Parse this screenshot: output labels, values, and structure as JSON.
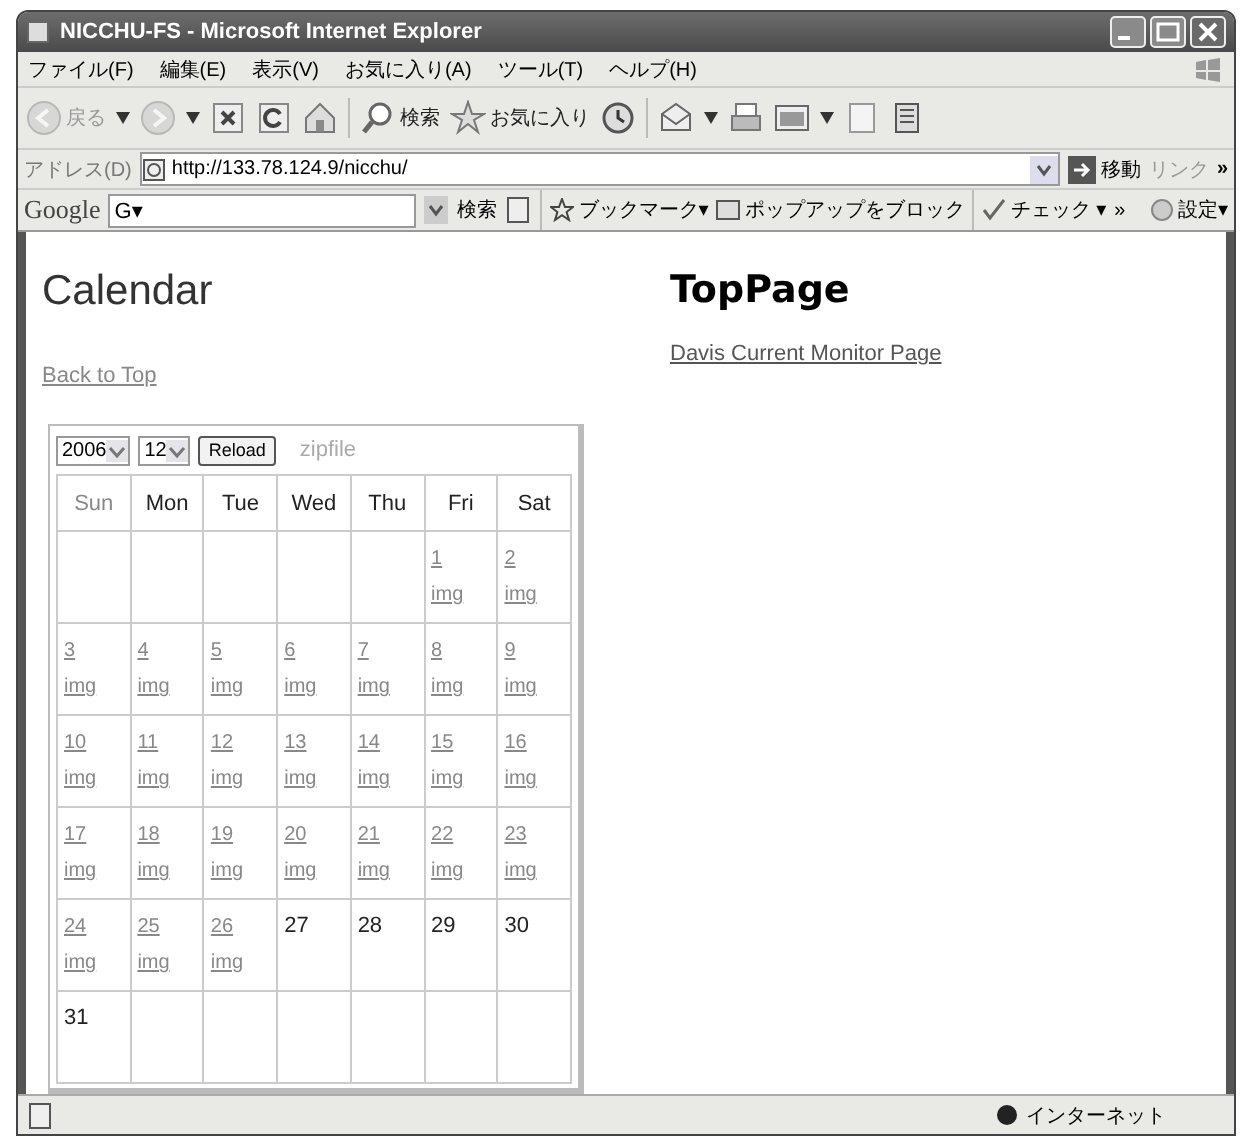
{
  "window": {
    "title": "NICCHU-FS - Microsoft Internet Explorer"
  },
  "menu": [
    "ファイル(F)",
    "編集(E)",
    "表示(V)",
    "お気に入り(A)",
    "ツール(T)",
    "ヘルプ(H)"
  ],
  "toolbar": [
    {
      "kind": "back",
      "label": "戻る",
      "dropdown": true,
      "disabled": true
    },
    {
      "kind": "forward",
      "dropdown": true,
      "disabled": true
    },
    {
      "kind": "stop",
      "disabled": false
    },
    {
      "kind": "refresh",
      "disabled": false
    },
    {
      "kind": "home",
      "disabled": false
    },
    {
      "kind": "search",
      "label": "検索",
      "disabled": false
    },
    {
      "kind": "favorites",
      "label": "お気に入り",
      "disabled": false
    },
    {
      "kind": "history",
      "disabled": false
    },
    {
      "kind": "mail",
      "dropdown": true,
      "disabled": false
    },
    {
      "kind": "print",
      "disabled": false
    },
    {
      "kind": "edit",
      "dropdown": true,
      "disabled": false
    },
    {
      "kind": "page",
      "disabled": false
    },
    {
      "kind": "research",
      "disabled": false
    }
  ],
  "address": {
    "label": "アドレス(D)",
    "url": "http://133.78.124.9/nicchu/",
    "go": "移動",
    "links": "リンク",
    "more": "»"
  },
  "google_bar": {
    "logo": "Google",
    "field": "G▾",
    "search": "検索",
    "bookmarks": "ブックマーク▾",
    "popup": "ポップアップをブロック",
    "check": "チェック ▾",
    "more": "»",
    "settings": "設定▾"
  },
  "calendar": {
    "title": "Calendar",
    "back_link": "Back to Top",
    "year": "2006",
    "month": "12",
    "reload": "Reload",
    "zipfile": "zipfile",
    "weekdays": [
      {
        "label": "Sun",
        "dimmed": true
      },
      {
        "label": "Mon",
        "dimmed": false
      },
      {
        "label": "Tue",
        "dimmed": false
      },
      {
        "label": "Wed",
        "dimmed": false
      },
      {
        "label": "Thu",
        "dimmed": false
      },
      {
        "label": "Fri",
        "dimmed": false
      },
      {
        "label": "Sat",
        "dimmed": false
      }
    ],
    "weeks": [
      [
        {
          "kind": "empty"
        },
        {
          "kind": "empty"
        },
        {
          "kind": "empty"
        },
        {
          "kind": "empty"
        },
        {
          "kind": "empty"
        },
        {
          "kind": "link",
          "day": "1",
          "img": "img"
        },
        {
          "kind": "link",
          "day": "2",
          "img": "img"
        }
      ],
      [
        {
          "kind": "link",
          "day": "3",
          "img": "img"
        },
        {
          "kind": "link",
          "day": "4",
          "img": "img"
        },
        {
          "kind": "link",
          "day": "5",
          "img": "img"
        },
        {
          "kind": "link",
          "day": "6",
          "img": "img"
        },
        {
          "kind": "link",
          "day": "7",
          "img": "img"
        },
        {
          "kind": "link",
          "day": "8",
          "img": "img"
        },
        {
          "kind": "link",
          "day": "9",
          "img": "img"
        }
      ],
      [
        {
          "kind": "link",
          "day": "10",
          "img": "img"
        },
        {
          "kind": "link",
          "day": "11",
          "img": "img"
        },
        {
          "kind": "link",
          "day": "12",
          "img": "img"
        },
        {
          "kind": "link",
          "day": "13",
          "img": "img"
        },
        {
          "kind": "link",
          "day": "14",
          "img": "img"
        },
        {
          "kind": "link",
          "day": "15",
          "img": "img"
        },
        {
          "kind": "link",
          "day": "16",
          "img": "img"
        }
      ],
      [
        {
          "kind": "link",
          "day": "17",
          "img": "img"
        },
        {
          "kind": "link",
          "day": "18",
          "img": "img"
        },
        {
          "kind": "link",
          "day": "19",
          "img": "img"
        },
        {
          "kind": "link",
          "day": "20",
          "img": "img"
        },
        {
          "kind": "link",
          "day": "21",
          "img": "img"
        },
        {
          "kind": "link",
          "day": "22",
          "img": "img"
        },
        {
          "kind": "link",
          "day": "23",
          "img": "img"
        }
      ],
      [
        {
          "kind": "link",
          "day": "24",
          "img": "img"
        },
        {
          "kind": "link",
          "day": "25",
          "img": "img"
        },
        {
          "kind": "link",
          "day": "26",
          "img": "img"
        },
        {
          "kind": "plain",
          "day": "27"
        },
        {
          "kind": "plain",
          "day": "28"
        },
        {
          "kind": "plain",
          "day": "29"
        },
        {
          "kind": "plain",
          "day": "30"
        }
      ],
      [
        {
          "kind": "plain",
          "day": "31"
        },
        {
          "kind": "empty"
        },
        {
          "kind": "empty"
        },
        {
          "kind": "empty"
        },
        {
          "kind": "empty"
        },
        {
          "kind": "empty"
        },
        {
          "kind": "empty"
        }
      ]
    ]
  },
  "top_page": {
    "title": "TopPage",
    "link": "Davis Current Monitor Page"
  },
  "status_bar": {
    "zone": "インターネット"
  }
}
